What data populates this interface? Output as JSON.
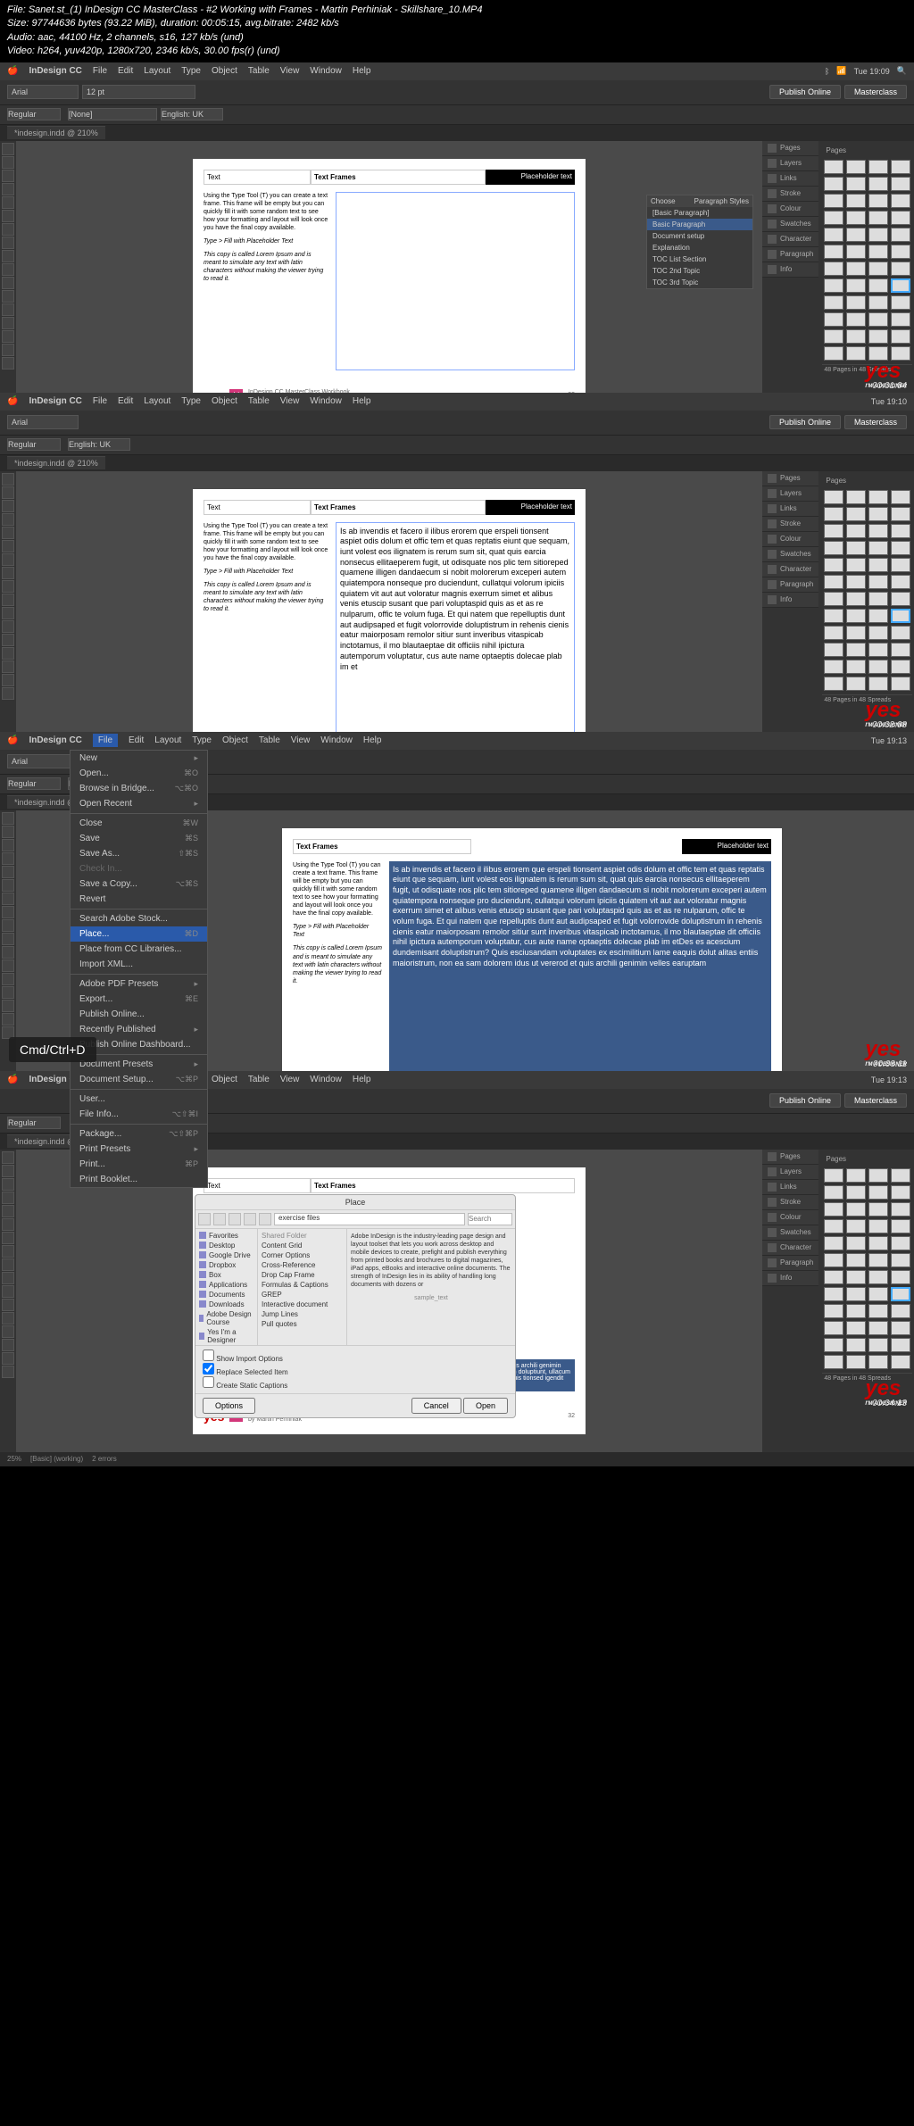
{
  "header": {
    "file": "File: Sanet.st_(1) InDesign CC MasterClass - #2 Working with Frames - Martin Perhiniak - Skillshare_10.MP4",
    "size": "Size: 97744636 bytes (93.22 MiB), duration: 00:05:15, avg.bitrate: 2482 kb/s",
    "audio": "Audio: aac, 44100 Hz, 2 channels, s16, 127 kb/s (und)",
    "video": "Video: h264, yuv420p, 1280x720, 2346 kb/s, 30.00 fps(r) (und)"
  },
  "app_name": "InDesign CC",
  "menus": [
    "File",
    "Edit",
    "Layout",
    "Type",
    "Object",
    "Table",
    "View",
    "Window",
    "Help"
  ],
  "clock1": "Tue 19:09",
  "clock2": "Tue 19:10",
  "clock3": "Tue 19:13",
  "clock4": "Tue 19:13",
  "publish": "Publish Online",
  "masterclass": "Masterclass",
  "font": "Arial",
  "weight": "Regular",
  "size": "12 pt",
  "lang": "English: UK",
  "para_none": "[None]",
  "tab_name": "*indesign.indd @ 210%",
  "tab_name3": "*indesign.indd @ 25%",
  "zoom1": "210%",
  "zoom4": "25%",
  "page_hdr": {
    "c1": "Text",
    "c2": "Text Frames",
    "c3": "Placeholder text"
  },
  "left_text": {
    "p1": "Using the Type Tool (T) you can create a text frame. This frame will be empty but you can quickly fill it with some random text to see how your formatting and layout will look once you have the final copy available.",
    "p2": "Type > Fill with Placeholder Text",
    "p3": "This copy is called Lorem Ipsum and is meant to simulate any text with latin characters without making the viewer trying to read it."
  },
  "placeholder_body": "Is ab invendis et facero il ilibus erorem que erspeli tionsent aspiet odis dolum et offic tem et quas reptatis eiunt que sequam, iunt volest eos ilignatem is rerum sum sit, quat quis earcia nonsecus ellitaeperem fugit, ut odisquate nos plic tem sitioreped quamene illigen dandaecum si nobit molorerum exceperi autem quiatempora nonseque pro duciendunt, cullatqui volorum ipiciis quiatem vit aut aut voloratur magnis exerrum simet et alibus venis etuscip susant que pari voluptaspid quis as et as re nulparum, offic te volum fuga. Et qui natem que repelluptis dunt aut audipsaped et fugit volorrovide doluptistrum in rehenis cienis eatur maiorposam remolor sitiur sunt inveribus vitaspicab inctotamus, il mo blautaeptae dit officiis nihil ipictura autemporum voluptatur, cus aute name optaeptis dolecae plab im et",
  "placeholder_body3": "Is ab invendis et facero il ilibus erorem que erspeli tionsent aspiet odis dolum et offic tem et quas reptatis eiunt que sequam, iunt volest eos ilignatem is rerum sum sit, quat quis earcia nonsecus ellitaeperem fugit, ut odisquate nos plic tem sitioreped quamene illigen dandaecum si nobit molorerum exceperi autem quiatempora nonseque pro duciendunt, cullatqui volorum ipiciis quiatem vit aut aut voloratur magnis exerrum simet et alibus venis etuscip susant que pari voluptaspid quis as et as re nulparum, offic te volum fuga. Et qui natem que repelluptis dunt aut audipsaped et fugit volorrovide doluptistrum in rehenis cienis eatur maiorposam remolor sitiur sunt inveribus vitaspicab inctotamus, il mo blautaeptae dit officiis nihil ipictura autemporum voluptatur, cus aute name optaeptis dolecae plab im etDes es acescium dundemisant doluptistrum? Quis esciusandam voluptates ex escimilitium lame eaquis dolut alitas entiis maioristrum, non ea sam dolorem idus ut vererod et quis archili genimin velles earuptam",
  "placeholder_body4": "voluptates ex escimilitium lame eaquis dolut alitas entiis maioristrum, non ea sam dolorem idus ut vererod et quis archili genimin velles earuptam molores vos siti omnimus simusci mporerro videst minvello porrorerit earum, conseaqu omnium doluptiunt, ullacum audi blaborerum aut in rescia pro conetatur quiae imilestis della sepelia doluptus mmenatel essed doles quo liquis tionsed igendit earum susa rate cum omnisitiur, siti resectotam et hit esque sum cum esciania sitin restotatem fa.",
  "footer": {
    "logo": "yes",
    "sub": "I'M A DESIGNER",
    "badge": "Id",
    "title": "InDesign CC MasterClass Workbook",
    "author": "by Martin Perhiniak",
    "page": "32"
  },
  "panels": [
    "Pages",
    "Layers",
    "Links",
    "Stroke",
    "Colour",
    "Swatches",
    "Character",
    "Paragraph",
    "Info"
  ],
  "pages_count": "48 Pages in 48 Spreads",
  "status": {
    "working": "[Basic] (working)",
    "errors": "2 errors"
  },
  "para_popup": {
    "title": "Paragraph Styles",
    "items": [
      "[Basic Paragraph]",
      "Basic Paragraph",
      "Document setup",
      "Explanation",
      "TOC List Section",
      "TOC 2nd Topic",
      "TOC 3rd Topic"
    ]
  },
  "file_menu": [
    {
      "l": "New",
      "s": "▸"
    },
    {
      "l": "Open...",
      "s": "⌘O"
    },
    {
      "l": "Browse in Bridge...",
      "s": "⌥⌘O"
    },
    {
      "l": "Open Recent",
      "s": "▸"
    },
    {
      "sep": true
    },
    {
      "l": "Close",
      "s": "⌘W"
    },
    {
      "l": "Save",
      "s": "⌘S"
    },
    {
      "l": "Save As...",
      "s": "⇧⌘S"
    },
    {
      "l": "Check In...",
      "dim": true
    },
    {
      "l": "Save a Copy...",
      "s": "⌥⌘S"
    },
    {
      "l": "Revert"
    },
    {
      "sep": true
    },
    {
      "l": "Search Adobe Stock..."
    },
    {
      "l": "Place...",
      "s": "⌘D",
      "sel": true
    },
    {
      "l": "Place from CC Libraries..."
    },
    {
      "l": "Import XML..."
    },
    {
      "sep": true
    },
    {
      "l": "Adobe PDF Presets",
      "s": "▸"
    },
    {
      "l": "Export...",
      "s": "⌘E"
    },
    {
      "l": "Publish Online..."
    },
    {
      "l": "Recently Published",
      "s": "▸"
    },
    {
      "l": "Publish Online Dashboard..."
    },
    {
      "sep": true
    },
    {
      "l": "Document Presets",
      "s": "▸"
    },
    {
      "l": "Document Setup...",
      "s": "⌥⌘P"
    },
    {
      "sep": true
    },
    {
      "l": "User..."
    },
    {
      "l": "File Info...",
      "s": "⌥⇧⌘I"
    },
    {
      "sep": true
    },
    {
      "l": "Package...",
      "s": "⌥⇧⌘P"
    },
    {
      "l": "Print Presets",
      "s": "▸"
    },
    {
      "l": "Print...",
      "s": "⌘P"
    },
    {
      "l": "Print Booklet..."
    }
  ],
  "kbd_hint": "Cmd/Ctrl+D",
  "place": {
    "title": "Place",
    "path": "exercise files",
    "search": "Search",
    "sidebar": [
      "Favorites",
      "Desktop",
      "Google Drive",
      "Dropbox",
      "Box",
      "Applications",
      "Documents",
      "Downloads",
      "Adobe Design Course",
      "Yes I'm a Designer"
    ],
    "shared": "Shared Folder",
    "files": [
      "Content Grid",
      "Corner Options",
      "Cross-Reference",
      "Drop Cap Frame",
      "Formulas & Captions",
      "GREP",
      "Interactive document",
      "Jump Lines",
      "Pull quotes"
    ],
    "preview": "Adobe InDesign is the industry-leading page design and layout toolset that lets you work across desktop and mobile devices to create, prefight and publish everything from printed books and brochures to digital magazines, iPad apps, eBooks and interactive online documents. The strength of InDesign lies in its ability of handling long documents with dozens or",
    "sample": "sample_text",
    "opts": [
      "Show Import Options",
      "Replace Selected Item",
      "Create Static Captions"
    ],
    "options_btn": "Options",
    "cancel": "Cancel",
    "open": "Open"
  },
  "timestamps": [
    "00:01:04",
    "00:02:08",
    "00:03:11",
    "00:04:13"
  ],
  "yes": "yes",
  "yes_sub": "I'M A DESIGNER"
}
